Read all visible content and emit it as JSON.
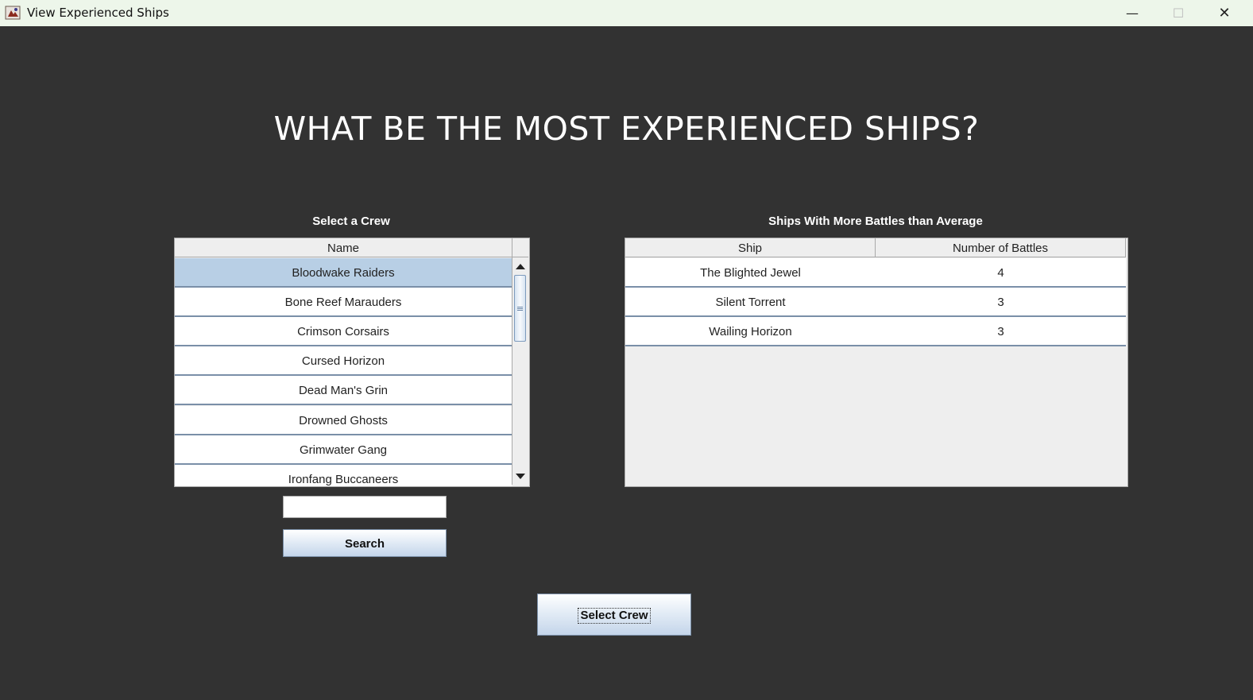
{
  "window": {
    "title": "View Experienced Ships",
    "minimize_glyph": "—",
    "maximize_glyph": "☐",
    "close_glyph": "✕"
  },
  "heading": "WHAT BE THE MOST EXPERIENCED SHIPS?",
  "crew_panel": {
    "label": "Select a Crew",
    "column_header": "Name",
    "rows": [
      "Bloodwake Raiders",
      "Bone Reef Marauders",
      "Crimson Corsairs",
      "Cursed Horizon",
      "Dead Man's Grin",
      "Drowned Ghosts",
      "Grimwater Gang",
      "Ironfang Buccaneers"
    ],
    "selected_index": 0
  },
  "ships_panel": {
    "label": "Ships With More Battles than Average",
    "columns": [
      "Ship",
      "Number of Battles"
    ],
    "rows": [
      {
        "ship": "The Blighted Jewel",
        "battles": "4"
      },
      {
        "ship": "Silent Torrent",
        "battles": "3"
      },
      {
        "ship": "Wailing Horizon",
        "battles": "3"
      }
    ]
  },
  "search": {
    "value": "",
    "placeholder": "",
    "button_label": "Search"
  },
  "select_crew_button": "Select Crew",
  "colors": {
    "background": "#323232",
    "selected_row": "#b8cfe5",
    "title_bar": "#edf6ea"
  }
}
